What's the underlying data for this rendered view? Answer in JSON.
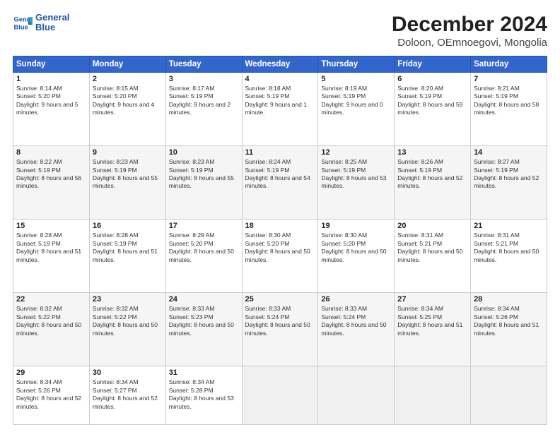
{
  "header": {
    "logo_line1": "General",
    "logo_line2": "Blue",
    "title": "December 2024",
    "subtitle": "Doloon, OEmnoegovi, Mongolia"
  },
  "weekdays": [
    "Sunday",
    "Monday",
    "Tuesday",
    "Wednesday",
    "Thursday",
    "Friday",
    "Saturday"
  ],
  "weeks": [
    [
      {
        "day": "1",
        "info": "Sunrise: 8:14 AM\nSunset: 5:20 PM\nDaylight: 9 hours and 5 minutes."
      },
      {
        "day": "2",
        "info": "Sunrise: 8:15 AM\nSunset: 5:20 PM\nDaylight: 9 hours and 4 minutes."
      },
      {
        "day": "3",
        "info": "Sunrise: 8:17 AM\nSunset: 5:19 PM\nDaylight: 9 hours and 2 minutes."
      },
      {
        "day": "4",
        "info": "Sunrise: 8:18 AM\nSunset: 5:19 PM\nDaylight: 9 hours and 1 minute."
      },
      {
        "day": "5",
        "info": "Sunrise: 8:19 AM\nSunset: 5:19 PM\nDaylight: 9 hours and 0 minutes."
      },
      {
        "day": "6",
        "info": "Sunrise: 8:20 AM\nSunset: 5:19 PM\nDaylight: 8 hours and 59 minutes."
      },
      {
        "day": "7",
        "info": "Sunrise: 8:21 AM\nSunset: 5:19 PM\nDaylight: 8 hours and 58 minutes."
      }
    ],
    [
      {
        "day": "8",
        "info": "Sunrise: 8:22 AM\nSunset: 5:19 PM\nDaylight: 8 hours and 56 minutes."
      },
      {
        "day": "9",
        "info": "Sunrise: 8:23 AM\nSunset: 5:19 PM\nDaylight: 8 hours and 55 minutes."
      },
      {
        "day": "10",
        "info": "Sunrise: 8:23 AM\nSunset: 5:19 PM\nDaylight: 8 hours and 55 minutes."
      },
      {
        "day": "11",
        "info": "Sunrise: 8:24 AM\nSunset: 5:19 PM\nDaylight: 8 hours and 54 minutes."
      },
      {
        "day": "12",
        "info": "Sunrise: 8:25 AM\nSunset: 5:19 PM\nDaylight: 8 hours and 53 minutes."
      },
      {
        "day": "13",
        "info": "Sunrise: 8:26 AM\nSunset: 5:19 PM\nDaylight: 8 hours and 52 minutes."
      },
      {
        "day": "14",
        "info": "Sunrise: 8:27 AM\nSunset: 5:19 PM\nDaylight: 8 hours and 52 minutes."
      }
    ],
    [
      {
        "day": "15",
        "info": "Sunrise: 8:28 AM\nSunset: 5:19 PM\nDaylight: 8 hours and 51 minutes."
      },
      {
        "day": "16",
        "info": "Sunrise: 8:28 AM\nSunset: 5:19 PM\nDaylight: 8 hours and 51 minutes."
      },
      {
        "day": "17",
        "info": "Sunrise: 8:29 AM\nSunset: 5:20 PM\nDaylight: 8 hours and 50 minutes."
      },
      {
        "day": "18",
        "info": "Sunrise: 8:30 AM\nSunset: 5:20 PM\nDaylight: 8 hours and 50 minutes."
      },
      {
        "day": "19",
        "info": "Sunrise: 8:30 AM\nSunset: 5:20 PM\nDaylight: 8 hours and 50 minutes."
      },
      {
        "day": "20",
        "info": "Sunrise: 8:31 AM\nSunset: 5:21 PM\nDaylight: 8 hours and 50 minutes."
      },
      {
        "day": "21",
        "info": "Sunrise: 8:31 AM\nSunset: 5:21 PM\nDaylight: 8 hours and 50 minutes."
      }
    ],
    [
      {
        "day": "22",
        "info": "Sunrise: 8:32 AM\nSunset: 5:22 PM\nDaylight: 8 hours and 50 minutes."
      },
      {
        "day": "23",
        "info": "Sunrise: 8:32 AM\nSunset: 5:22 PM\nDaylight: 8 hours and 50 minutes."
      },
      {
        "day": "24",
        "info": "Sunrise: 8:33 AM\nSunset: 5:23 PM\nDaylight: 8 hours and 50 minutes."
      },
      {
        "day": "25",
        "info": "Sunrise: 8:33 AM\nSunset: 5:24 PM\nDaylight: 8 hours and 50 minutes."
      },
      {
        "day": "26",
        "info": "Sunrise: 8:33 AM\nSunset: 5:24 PM\nDaylight: 8 hours and 50 minutes."
      },
      {
        "day": "27",
        "info": "Sunrise: 8:34 AM\nSunset: 5:25 PM\nDaylight: 8 hours and 51 minutes."
      },
      {
        "day": "28",
        "info": "Sunrise: 8:34 AM\nSunset: 5:26 PM\nDaylight: 8 hours and 51 minutes."
      }
    ],
    [
      {
        "day": "29",
        "info": "Sunrise: 8:34 AM\nSunset: 5:26 PM\nDaylight: 8 hours and 52 minutes."
      },
      {
        "day": "30",
        "info": "Sunrise: 8:34 AM\nSunset: 5:27 PM\nDaylight: 8 hours and 52 minutes."
      },
      {
        "day": "31",
        "info": "Sunrise: 8:34 AM\nSunset: 5:28 PM\nDaylight: 8 hours and 53 minutes."
      },
      null,
      null,
      null,
      null
    ]
  ]
}
